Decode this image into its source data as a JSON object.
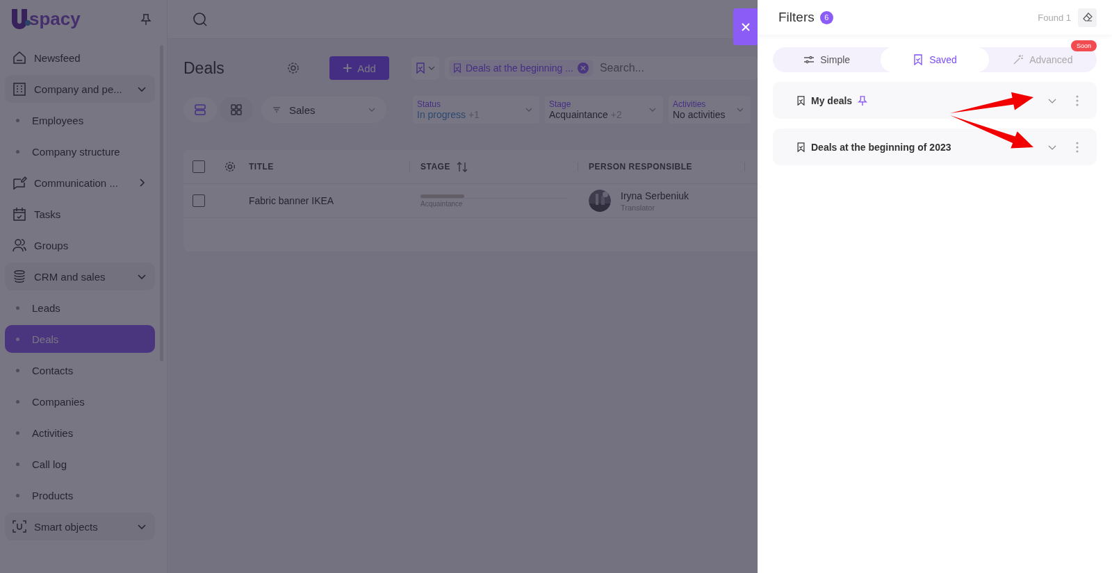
{
  "sidebar": {
    "logo": "spacy",
    "items": [
      {
        "label": "Newsfeed",
        "kind": "link",
        "selected": false
      },
      {
        "label": "Company and pe...",
        "kind": "group",
        "expanded": true,
        "children": [
          {
            "label": "Employees",
            "selected": false
          },
          {
            "label": "Company structure",
            "selected": false
          }
        ]
      },
      {
        "label": "Communication ...",
        "kind": "group",
        "expanded": false
      },
      {
        "label": "Tasks",
        "kind": "link",
        "selected": false
      },
      {
        "label": "Groups",
        "kind": "link",
        "selected": false
      },
      {
        "label": "CRM and sales",
        "kind": "group",
        "expanded": true,
        "children": [
          {
            "label": "Leads",
            "selected": false
          },
          {
            "label": "Deals",
            "selected": true
          },
          {
            "label": "Contacts",
            "selected": false
          },
          {
            "label": "Companies",
            "selected": false
          },
          {
            "label": "Activities",
            "selected": false
          },
          {
            "label": "Call log",
            "selected": false
          },
          {
            "label": "Products",
            "selected": false
          }
        ]
      },
      {
        "label": "Smart objects",
        "kind": "group",
        "expanded": true
      }
    ]
  },
  "main": {
    "title": "Deals",
    "add_button": "Add",
    "saved_filter_chip": "Deals at the beginning ...",
    "search": {
      "placeholder": "Search..."
    },
    "views": [
      {
        "kind": "list",
        "selected": true
      },
      {
        "kind": "grid",
        "selected": false
      }
    ],
    "pipeline": "Sales",
    "filters": [
      {
        "label": "Status",
        "value": "In progress",
        "extra": "+1",
        "kind": "status"
      },
      {
        "label": "Stage",
        "value": "Acquaintance",
        "extra": "+2",
        "kind": "plain"
      },
      {
        "label": "Activities",
        "value": "No activities",
        "kind": "plain"
      }
    ],
    "table": {
      "all_checked": false,
      "columns": [
        "TITLE",
        "STAGE",
        "PERSON RESPONSIBLE"
      ],
      "rows": [
        {
          "checked": false,
          "title": "Fabric banner IKEA",
          "stage": {
            "label": "Acquaintance",
            "level": 0.3
          },
          "person": {
            "name": "Iryna Serbeniuk",
            "role": "Translator"
          }
        }
      ]
    }
  },
  "filters_panel": {
    "title": "Filters",
    "count": "6",
    "found": "Found 1",
    "tabs": [
      {
        "label": "Simple",
        "selected": false,
        "disabled": false
      },
      {
        "label": "Saved",
        "selected": true,
        "disabled": false
      },
      {
        "label": "Advanced",
        "selected": false,
        "disabled": true,
        "badge": "Soon"
      }
    ],
    "saved": [
      {
        "name": "My deals",
        "pinned": true
      },
      {
        "name": "Deals at the beginning of 2023",
        "pinned": false
      }
    ]
  }
}
